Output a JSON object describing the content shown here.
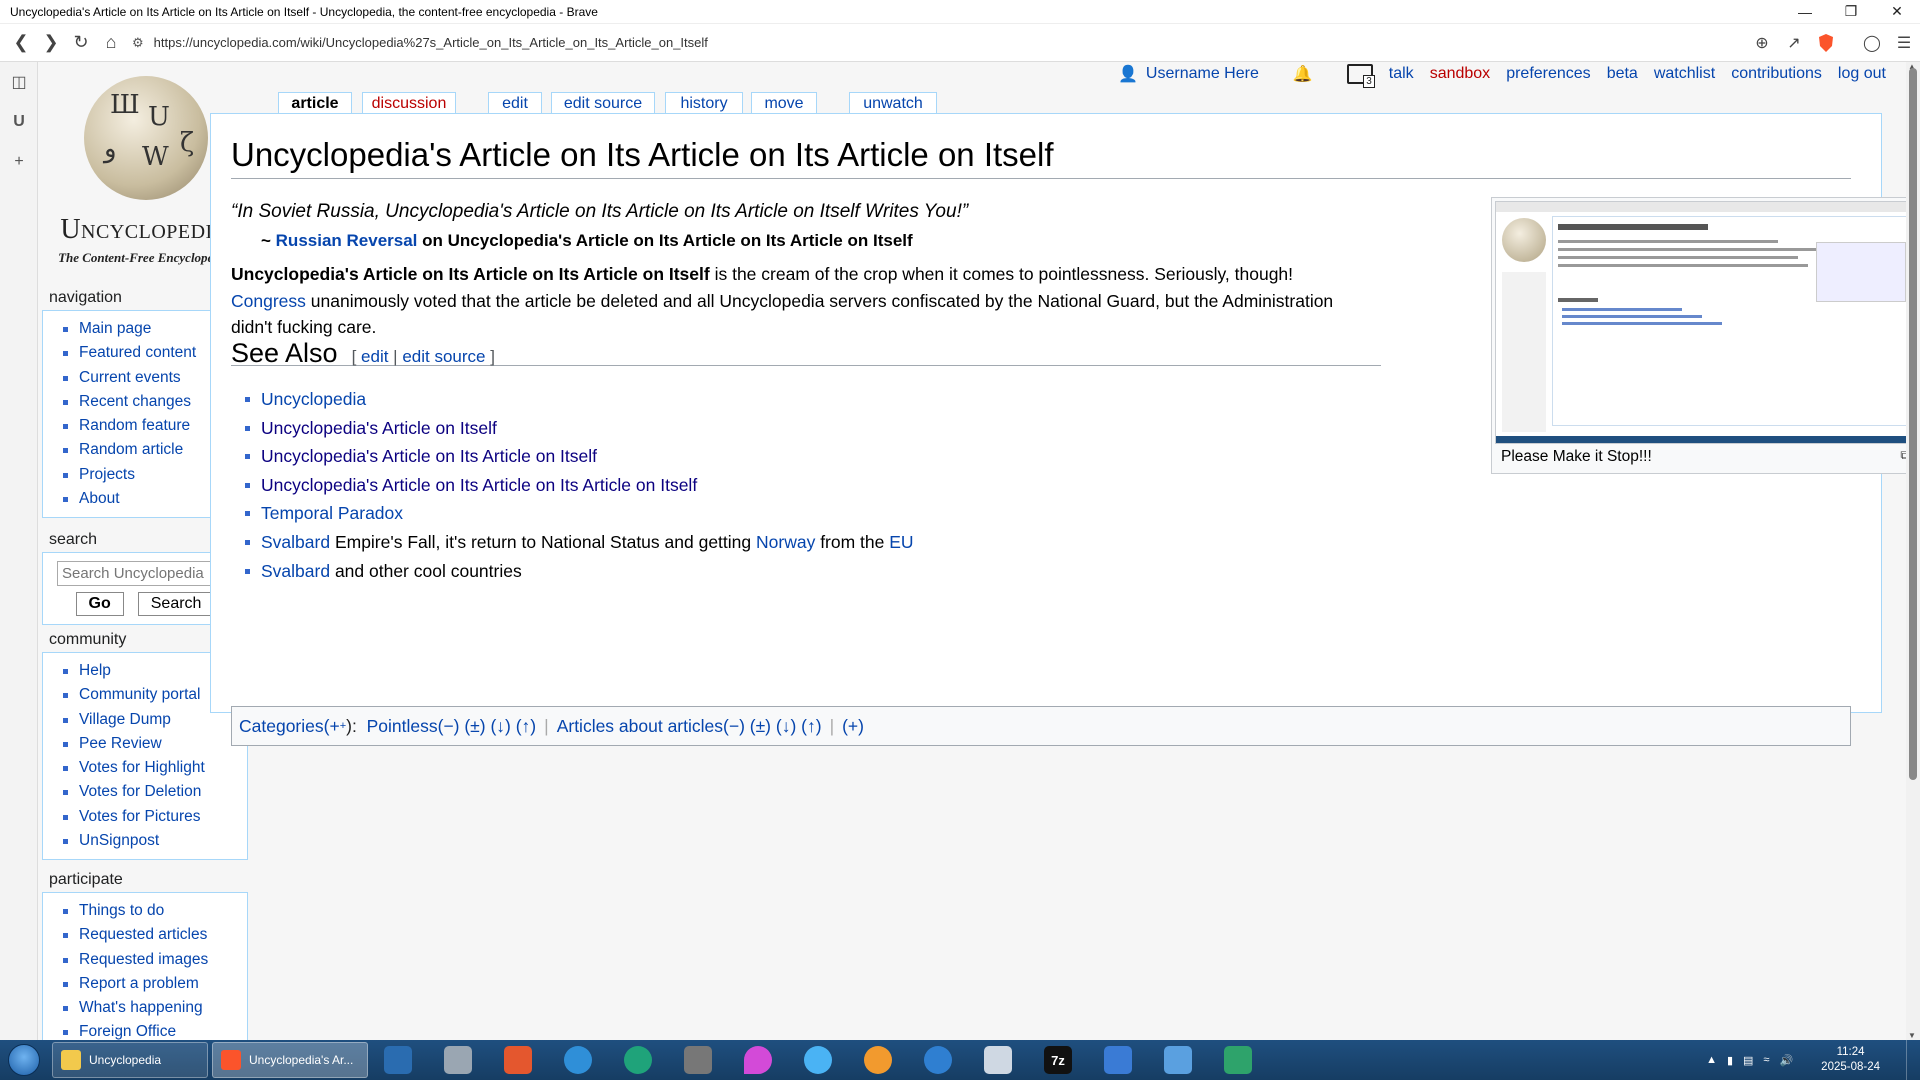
{
  "window": {
    "title": "Uncyclopedia's Article on Its Article on Its Article on Itself - Uncyclopedia, the content-free encyclopedia - Brave"
  },
  "browser": {
    "url": "https://uncyclopedia.com/wiki/Uncyclopedia%27s_Article_on_Its_Article_on_Its_Article_on_Itself"
  },
  "logo": {
    "wordmark": "Uncyclopedia",
    "tagline": "The Content-Free Encyclopedia"
  },
  "personal": {
    "username": "Username Here",
    "notifications_count": "3",
    "links": [
      "talk",
      "sandbox",
      "preferences",
      "beta",
      "watchlist",
      "contributions",
      "log out"
    ]
  },
  "tabs": {
    "article": "article",
    "discussion": "discussion",
    "edit": "edit",
    "edit_source": "edit source",
    "history": "history",
    "move": "move",
    "unwatch": "unwatch"
  },
  "sidebar": {
    "navigation": {
      "heading": "navigation",
      "items": [
        "Main page",
        "Featured content",
        "Current events",
        "Recent changes",
        "Random feature",
        "Random article",
        "Projects",
        "About"
      ]
    },
    "search": {
      "heading": "search",
      "placeholder": "Search Uncyclopedia",
      "go": "Go",
      "search": "Search"
    },
    "community": {
      "heading": "community",
      "items": [
        "Help",
        "Community portal",
        "Village Dump",
        "Pee Review",
        "Votes for Highlight",
        "Votes for Deletion",
        "Votes for Pictures",
        "UnSignpost"
      ]
    },
    "participate": {
      "heading": "participate",
      "items": [
        "Things to do",
        "Requested articles",
        "Requested images",
        "Report a problem",
        "What's happening",
        "Foreign Office"
      ]
    }
  },
  "article": {
    "title": "Uncyclopedia's Article on Its Article on Its Article on Itself",
    "quote": "“In Soviet Russia, Uncyclopedia's Article on Its Article on Its Article on Itself Writes You!”",
    "attribution_prefix": "~ ",
    "attribution_link": "Russian Reversal",
    "attribution_suffix": " on Uncyclopedia's Article on Its Article on Its Article on Itself",
    "body_bold": "Uncyclopedia's Article on Its Article on Its Article on Itself",
    "body_1": " is the cream of the crop when it comes to pointlessness. Seriously, though!",
    "body_link": "Congress",
    "body_2": " unanimously voted that the article be deleted and all Uncyclopedia servers confiscated by the National Guard, but the Administration didn't fucking care.",
    "see_also": {
      "heading": "See Also",
      "bracket_open": "[ ",
      "edit": "edit",
      "pipe": " | ",
      "edit_source": "edit source",
      "bracket_close": " ]",
      "items": {
        "i1": "Uncyclopedia",
        "i2": "Uncyclopedia's Article on Itself",
        "i3": "Uncyclopedia's Article on Its Article on Itself",
        "i4": "Uncyclopedia's Article on Its Article on Its Article on Itself",
        "i5": "Temporal Paradox",
        "i6_link1": "Svalbard",
        "i6_text1": " Empire's Fall, it's return to National Status and getting ",
        "i6_link2": "Norway",
        "i6_text2": " from the ",
        "i6_link3": "EU",
        "i7_link": "Svalbard",
        "i7_text": " and other cool countries"
      }
    },
    "thumb_caption": "Please Make it Stop!!!"
  },
  "categories": {
    "label": "Categories",
    "label_suffix": " (+",
    "sup": "+",
    "label_end": "):",
    "cat1": "Pointless",
    "cat1_tools": " (−) (±) (↓) (↑)",
    "cat2": "Articles about articles",
    "cat2_tools": " (−) (±) (↓) (↑)",
    "add": "(+)"
  },
  "taskbar": {
    "app1": "Uncyclopedia",
    "app2": "Uncyclopedia's Ar...",
    "time": "11:24",
    "date": "2025-08-24"
  }
}
